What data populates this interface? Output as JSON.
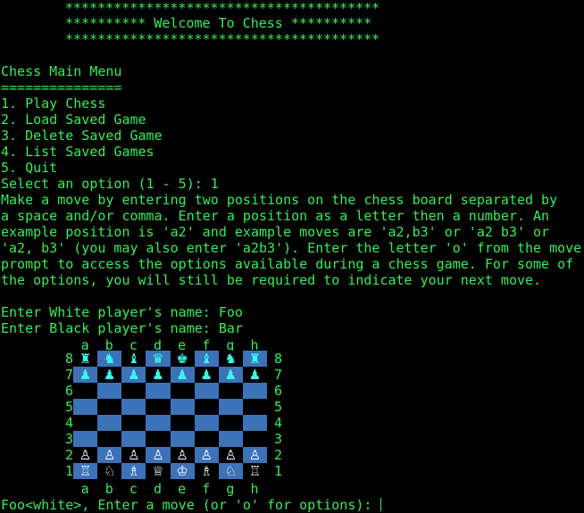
{
  "colors": {
    "terminal_bg": "#000000",
    "terminal_text": "#33ee55",
    "board_dark": "#3c72b8",
    "board_light": "#000000",
    "black_piece": "#33ffee",
    "white_piece": "#ffffff"
  },
  "banner": {
    "top": "***************************************",
    "middle": "********** Welcome To Chess **********",
    "bottom": "***************************************"
  },
  "menu": {
    "title": "Chess Main Menu",
    "underline": "===============",
    "options": [
      "1. Play Chess",
      "2. Load Saved Game",
      "3. Delete Saved Game",
      "4. List Saved Games",
      "5. Quit"
    ],
    "prompt": "Select an option (1 - 5): 1"
  },
  "instructions": [
    "Make a move by entering two positions on the chess board separated by",
    "a space and/or comma. Enter a position as a letter then a number. An",
    "example position is 'a2' and example moves are 'a2,b3' or 'a2 b3' or",
    "'a2, b3' (you may also enter 'a2b3'). Enter the letter 'o' from the move",
    "prompt to access the options available during a chess game. For some of",
    "the options, you will still be required to indicate your next move."
  ],
  "players": {
    "white_prompt": "Enter White player's name: Foo",
    "black_prompt": "Enter Black player's name: Bar"
  },
  "board": {
    "files": [
      "a",
      "b",
      "c",
      "d",
      "e",
      "f",
      "g",
      "h"
    ],
    "ranks": [
      "8",
      "7",
      "6",
      "5",
      "4",
      "3",
      "2",
      "1"
    ],
    "rows": [
      [
        "♜",
        "♞",
        "♝",
        "♛",
        "♚",
        "♝",
        "♞",
        "♜"
      ],
      [
        "♟",
        "♟",
        "♟",
        "♟",
        "♟",
        "♟",
        "♟",
        "♟"
      ],
      [
        "",
        "",
        "",
        "",
        "",
        "",
        "",
        ""
      ],
      [
        "",
        "",
        "",
        "",
        "",
        "",
        "",
        ""
      ],
      [
        "",
        "",
        "",
        "",
        "",
        "",
        "",
        ""
      ],
      [
        "",
        "",
        "",
        "",
        "",
        "",
        "",
        ""
      ],
      [
        "♙",
        "♙",
        "♙",
        "♙",
        "♙",
        "♙",
        "♙",
        "♙"
      ],
      [
        "♖",
        "♘",
        "♗",
        "♕",
        "♔",
        "♗",
        "♘",
        "♖"
      ]
    ]
  },
  "move_prompt": "Foo<white>, Enter a move (or 'o' for options): "
}
